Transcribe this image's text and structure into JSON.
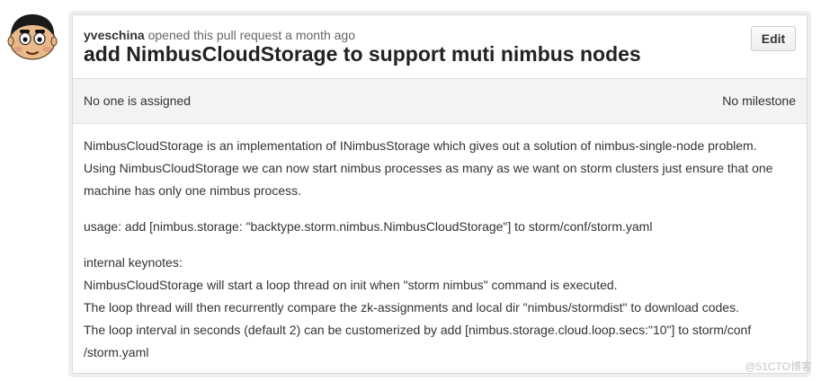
{
  "author": {
    "username": "yveschina",
    "action_text": "opened this pull request a month ago"
  },
  "pull_request": {
    "title": "add NimbusCloudStorage to support muti nimbus nodes",
    "edit_label": "Edit",
    "assignee_text": "No one is assigned",
    "milestone_text": "No milestone"
  },
  "description": {
    "intro_line1": "NimbusCloudStorage is an implementation of INimbusStorage which gives out a solution of nimbus-single-node problem.",
    "intro_line2": "Using NimbusCloudStorage we can now start nimbus processes as many as we want on storm clusters just ensure that one",
    "intro_line3": "machine has only one nimbus process.",
    "usage_line": "usage: add [nimbus.storage: \"backtype.storm.nimbus.NimbusCloudStorage\"] to storm/conf/storm.yaml",
    "keynotes_heading": "internal keynotes:",
    "keynote_line1": "NimbusCloudStorage will start a loop thread on init when \"storm nimbus\" command is executed.",
    "keynote_line2": "The loop thread will then recurrently compare the zk-assignments and local dir \"nimbus/stormdist\" to download codes.",
    "keynote_line3": "The loop interval in seconds (default 2) can be customerized by add [nimbus.storage.cloud.loop.secs:\"10\"] to storm/conf",
    "keynote_line4": "/storm.yaml"
  },
  "watermark": "@51CTO博客",
  "colors": {
    "title": "#222222",
    "text": "#333333",
    "sidebar_bg": "#f3f3f3",
    "border": "#d8d8d8"
  },
  "icons": {
    "avatar": "cartoon-face-avatar"
  }
}
